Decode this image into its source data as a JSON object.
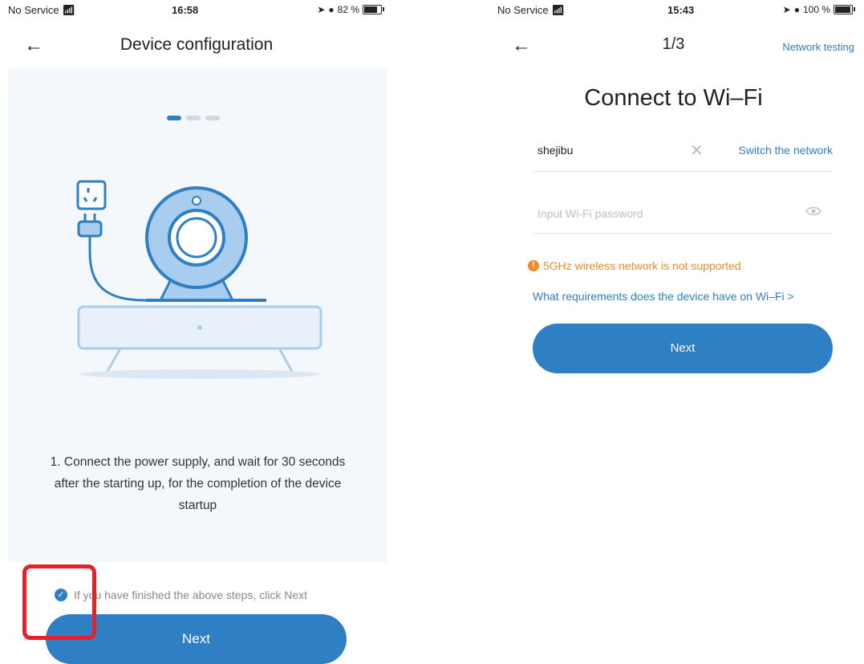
{
  "left_screen": {
    "status": {
      "carrier": "No Service",
      "time": "16:58",
      "battery": "82 %",
      "battery_level": 0.82
    },
    "nav": {
      "title": "Device configuration"
    },
    "pager": {
      "total": 3,
      "current": 1
    },
    "step_text": "1. Connect the power supply, and wait for 30 seconds after the starting up, for the completion of the device startup",
    "confirm_text": "If you have finished the above steps, click Next",
    "next_label": "Next"
  },
  "right_screen": {
    "status": {
      "carrier": "No Service",
      "time": "15:43",
      "battery": "100 %",
      "battery_level": 1.0
    },
    "nav": {
      "step": "1/3",
      "network_testing": "Network testing"
    },
    "title": "Connect to Wi–Fi",
    "ssid": "shejibu",
    "switch_network": "Switch the network",
    "password_placeholder": "Input Wi-Fi password",
    "warning": "5GHz wireless network is not supported",
    "requirements_link": "What requirements does the device have on Wi–Fi >",
    "next_label": "Next"
  },
  "colors": {
    "accent": "#2f7fc4",
    "warning": "#f08a2c",
    "highlight": "#e8202a"
  }
}
